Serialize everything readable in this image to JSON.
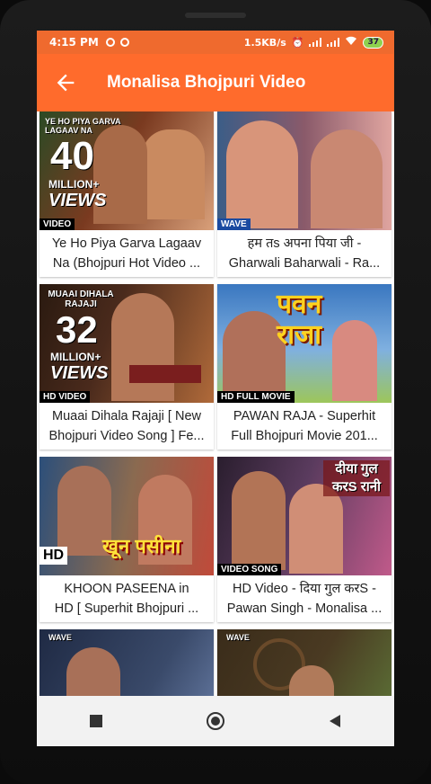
{
  "status": {
    "time": "4:15 PM",
    "speed": "1.5KB/s",
    "battery": "37"
  },
  "appbar": {
    "title": "Monalisa Bhojpuri Video"
  },
  "videos": [
    {
      "title_line1": "Ye Ho Piya Garva Lagaav",
      "title_line2": "Na (Bhojpuri Hot Video ...",
      "overlay_top": "YE HO PIYA GARVA LAGAAV NA",
      "overlay_count": "40",
      "overlay_million": "MILLION+",
      "overlay_views": "VIEWS",
      "tag": "VIDEO",
      "colors": [
        "#7a3a20",
        "#d9a07a"
      ]
    },
    {
      "title_line1": "हम तs अपना पिया जी -",
      "title_line2": "Gharwali Baharwali - Ra...",
      "tag": "WAVE",
      "colors": [
        "#3b5d87",
        "#e0a5a0"
      ]
    },
    {
      "title_line1": "Muaai Dihala Rajaji [ New",
      "title_line2": "Bhojpuri Video Song ] Fe...",
      "overlay_top": "MUAAI DIHALA RAJAJI",
      "overlay_count": "32",
      "overlay_million": "MILLION+",
      "overlay_views": "VIEWS",
      "tag": "HD VIDEO",
      "colors": [
        "#4a2a1c",
        "#b06a3a"
      ]
    },
    {
      "title_line1": "PAWAN RAJA - Superhit",
      "title_line2": "Full Bhojpuri Movie 201...",
      "overlay_hindi": "पवन राजा",
      "tag": "HD FULL MOVIE",
      "colors": [
        "#3a77c0",
        "#9dc65a"
      ]
    },
    {
      "title_line1": "KHOON PASEENA in",
      "title_line2": "HD [ Superhit Bhojpuri ...",
      "overlay_hindi": "खून पसीना",
      "tag": "HD",
      "colors": [
        "#2c4f7a",
        "#c04a3a"
      ]
    },
    {
      "title_line1": "HD Video - दिया गुल करS -",
      "title_line2": "Pawan Singh - Monalisa ...",
      "overlay_hindi": "दीया गुल करS रानी",
      "tag": "VIDEO SONG",
      "colors": [
        "#5a3b5e",
        "#c05a8a"
      ]
    },
    {
      "title_line1": "",
      "title_line2": "",
      "tag": "WAVE",
      "colors": [
        "#1f2a44",
        "#6a7fa8"
      ]
    },
    {
      "title_line1": "",
      "title_line2": "",
      "tag": "WAVE",
      "colors": [
        "#3a2c1a",
        "#5f7a3a"
      ]
    }
  ],
  "nav": {
    "recent": "recent-apps",
    "home": "home",
    "back": "back"
  }
}
